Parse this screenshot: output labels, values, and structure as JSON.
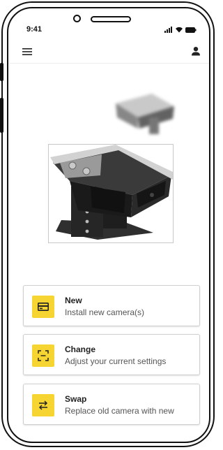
{
  "status_bar": {
    "time": "9:41"
  },
  "app_bar": {
    "menu_icon": "hamburger-menu-icon",
    "profile_icon": "user-icon"
  },
  "hero": {
    "image": "vehicle-camera-illustration"
  },
  "options": [
    {
      "title": "New",
      "subtitle": "Install new camera(s)",
      "icon": "camera-card-icon",
      "accent": "#f6d533"
    },
    {
      "title": "Change",
      "subtitle": "Adjust your current settings",
      "icon": "frame-scan-icon",
      "accent": "#f6d533"
    },
    {
      "title": "Swap",
      "subtitle": "Replace old camera with new",
      "icon": "swap-arrows-icon",
      "accent": "#f6d533"
    }
  ]
}
